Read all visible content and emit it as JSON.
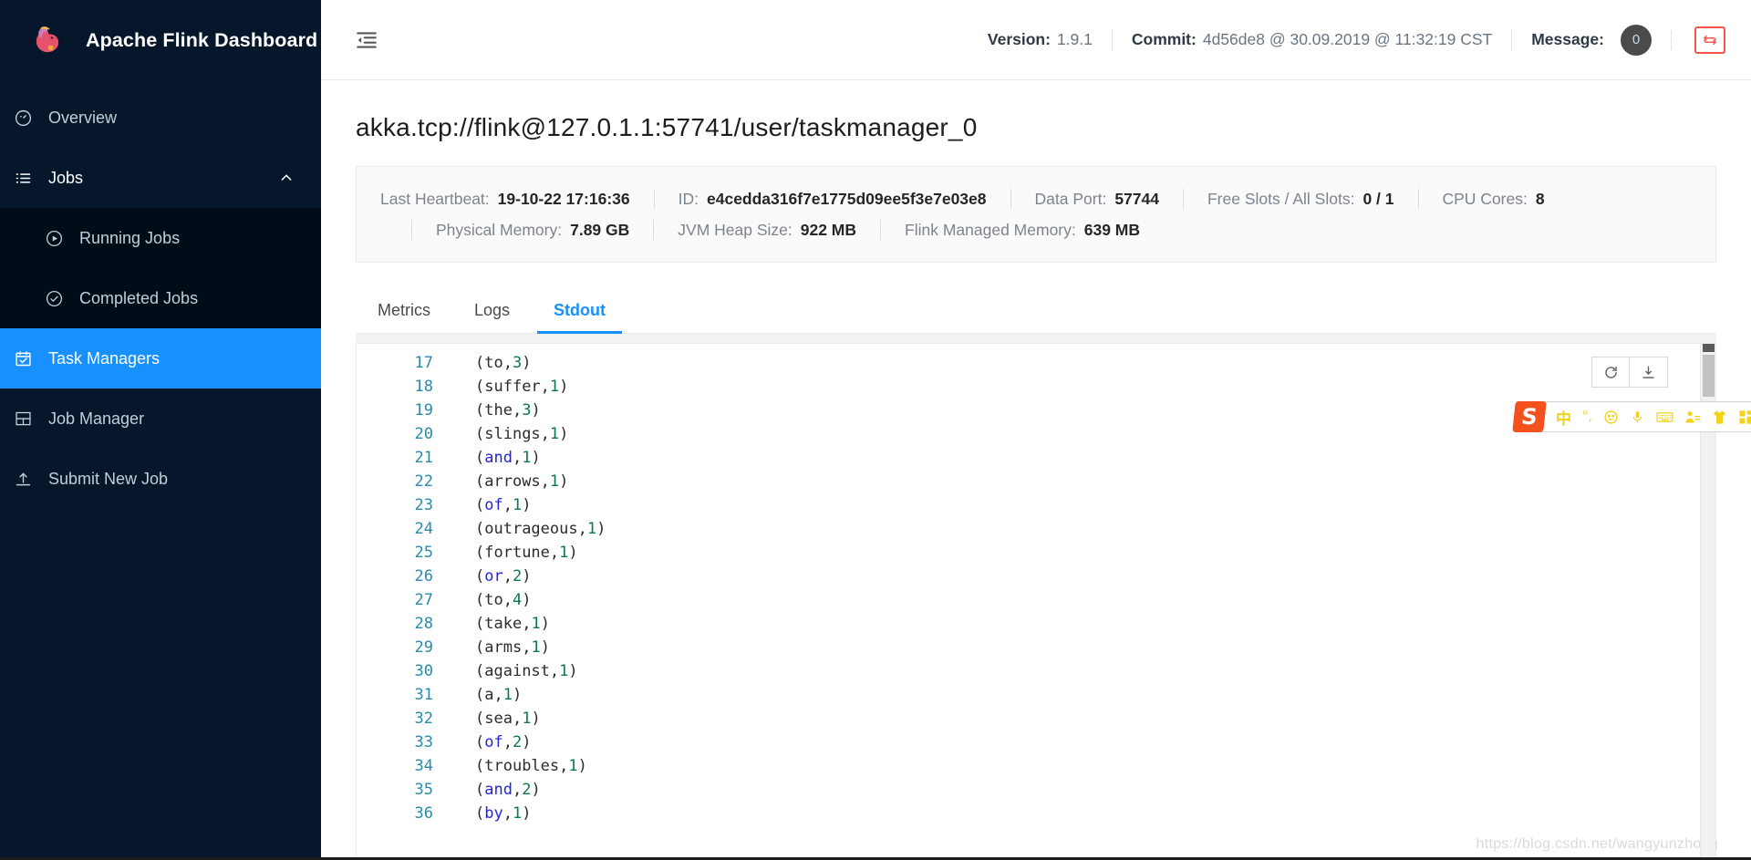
{
  "sidebar": {
    "brand_title": "Apache Flink Dashboard",
    "items": [
      {
        "label": "Overview",
        "icon": "dashboard-icon"
      },
      {
        "label": "Jobs",
        "icon": "list-icon"
      },
      {
        "label": "Running Jobs",
        "icon": "play-circle-icon"
      },
      {
        "label": "Completed Jobs",
        "icon": "check-circle-icon"
      },
      {
        "label": "Task Managers",
        "icon": "calendar-check-icon"
      },
      {
        "label": "Job Manager",
        "icon": "layout-grid-icon"
      },
      {
        "label": "Submit New Job",
        "icon": "upload-icon"
      }
    ]
  },
  "topbar": {
    "fold_icon": "menu-fold-icon",
    "version_label": "Version:",
    "version_value": "1.9.1",
    "commit_label": "Commit:",
    "commit_value": "4d56de8 @ 30.09.2019 @ 11:32:19 CST",
    "message_label": "Message:",
    "message_count": "0",
    "refresh_icon": "refresh-toggle-icon"
  },
  "page": {
    "title": "akka.tcp://flink@127.0.1.1:57741/user/taskmanager_0",
    "info_row1": [
      {
        "label": "Last Heartbeat:",
        "value": "19-10-22 17:16:36"
      },
      {
        "label": "ID:",
        "value": "e4cedda316f7e1775d09ee5f3e7e03e8"
      },
      {
        "label": "Data Port:",
        "value": "57744"
      },
      {
        "label": "Free Slots / All Slots:",
        "value": "0 / 1"
      },
      {
        "label": "CPU Cores:",
        "value": "8"
      }
    ],
    "info_row2": [
      {
        "label": "Physical Memory:",
        "value": "7.89 GB"
      },
      {
        "label": "JVM Heap Size:",
        "value": "922 MB"
      },
      {
        "label": "Flink Managed Memory:",
        "value": "639 MB"
      }
    ],
    "tabs": [
      {
        "label": "Metrics",
        "active": false
      },
      {
        "label": "Logs",
        "active": false
      },
      {
        "label": "Stdout",
        "active": true
      }
    ]
  },
  "code": {
    "refresh_icon": "reload-icon",
    "download_icon": "download-icon",
    "lines": [
      {
        "n": "17",
        "word": "to",
        "count": "3",
        "kw": false
      },
      {
        "n": "18",
        "word": "suffer",
        "count": "1",
        "kw": false
      },
      {
        "n": "19",
        "word": "the",
        "count": "3",
        "kw": false
      },
      {
        "n": "20",
        "word": "slings",
        "count": "1",
        "kw": false
      },
      {
        "n": "21",
        "word": "and",
        "count": "1",
        "kw": true
      },
      {
        "n": "22",
        "word": "arrows",
        "count": "1",
        "kw": false
      },
      {
        "n": "23",
        "word": "of",
        "count": "1",
        "kw": true
      },
      {
        "n": "24",
        "word": "outrageous",
        "count": "1",
        "kw": false
      },
      {
        "n": "25",
        "word": "fortune",
        "count": "1",
        "kw": false
      },
      {
        "n": "26",
        "word": "or",
        "count": "2",
        "kw": true
      },
      {
        "n": "27",
        "word": "to",
        "count": "4",
        "kw": false
      },
      {
        "n": "28",
        "word": "take",
        "count": "1",
        "kw": false
      },
      {
        "n": "29",
        "word": "arms",
        "count": "1",
        "kw": false
      },
      {
        "n": "30",
        "word": "against",
        "count": "1",
        "kw": false
      },
      {
        "n": "31",
        "word": "a",
        "count": "1",
        "kw": false
      },
      {
        "n": "32",
        "word": "sea",
        "count": "1",
        "kw": false
      },
      {
        "n": "33",
        "word": "of",
        "count": "2",
        "kw": true
      },
      {
        "n": "34",
        "word": "troubles",
        "count": "1",
        "kw": false
      },
      {
        "n": "35",
        "word": "and",
        "count": "2",
        "kw": true
      },
      {
        "n": "36",
        "word": "by",
        "count": "1",
        "kw": true
      }
    ]
  },
  "ime": {
    "logo": "S",
    "items": [
      "中",
      "°,",
      "☺",
      "mic-icon",
      "keyboard-icon",
      "person-icon",
      "shirt-icon",
      "apps-icon"
    ]
  },
  "watermark": "https://blog.csdn.net/wangyunzhong",
  "colors": {
    "accent": "#1890ff",
    "sidebar": "#06172c",
    "submenu": "#000c17",
    "red": "#f5564a"
  }
}
